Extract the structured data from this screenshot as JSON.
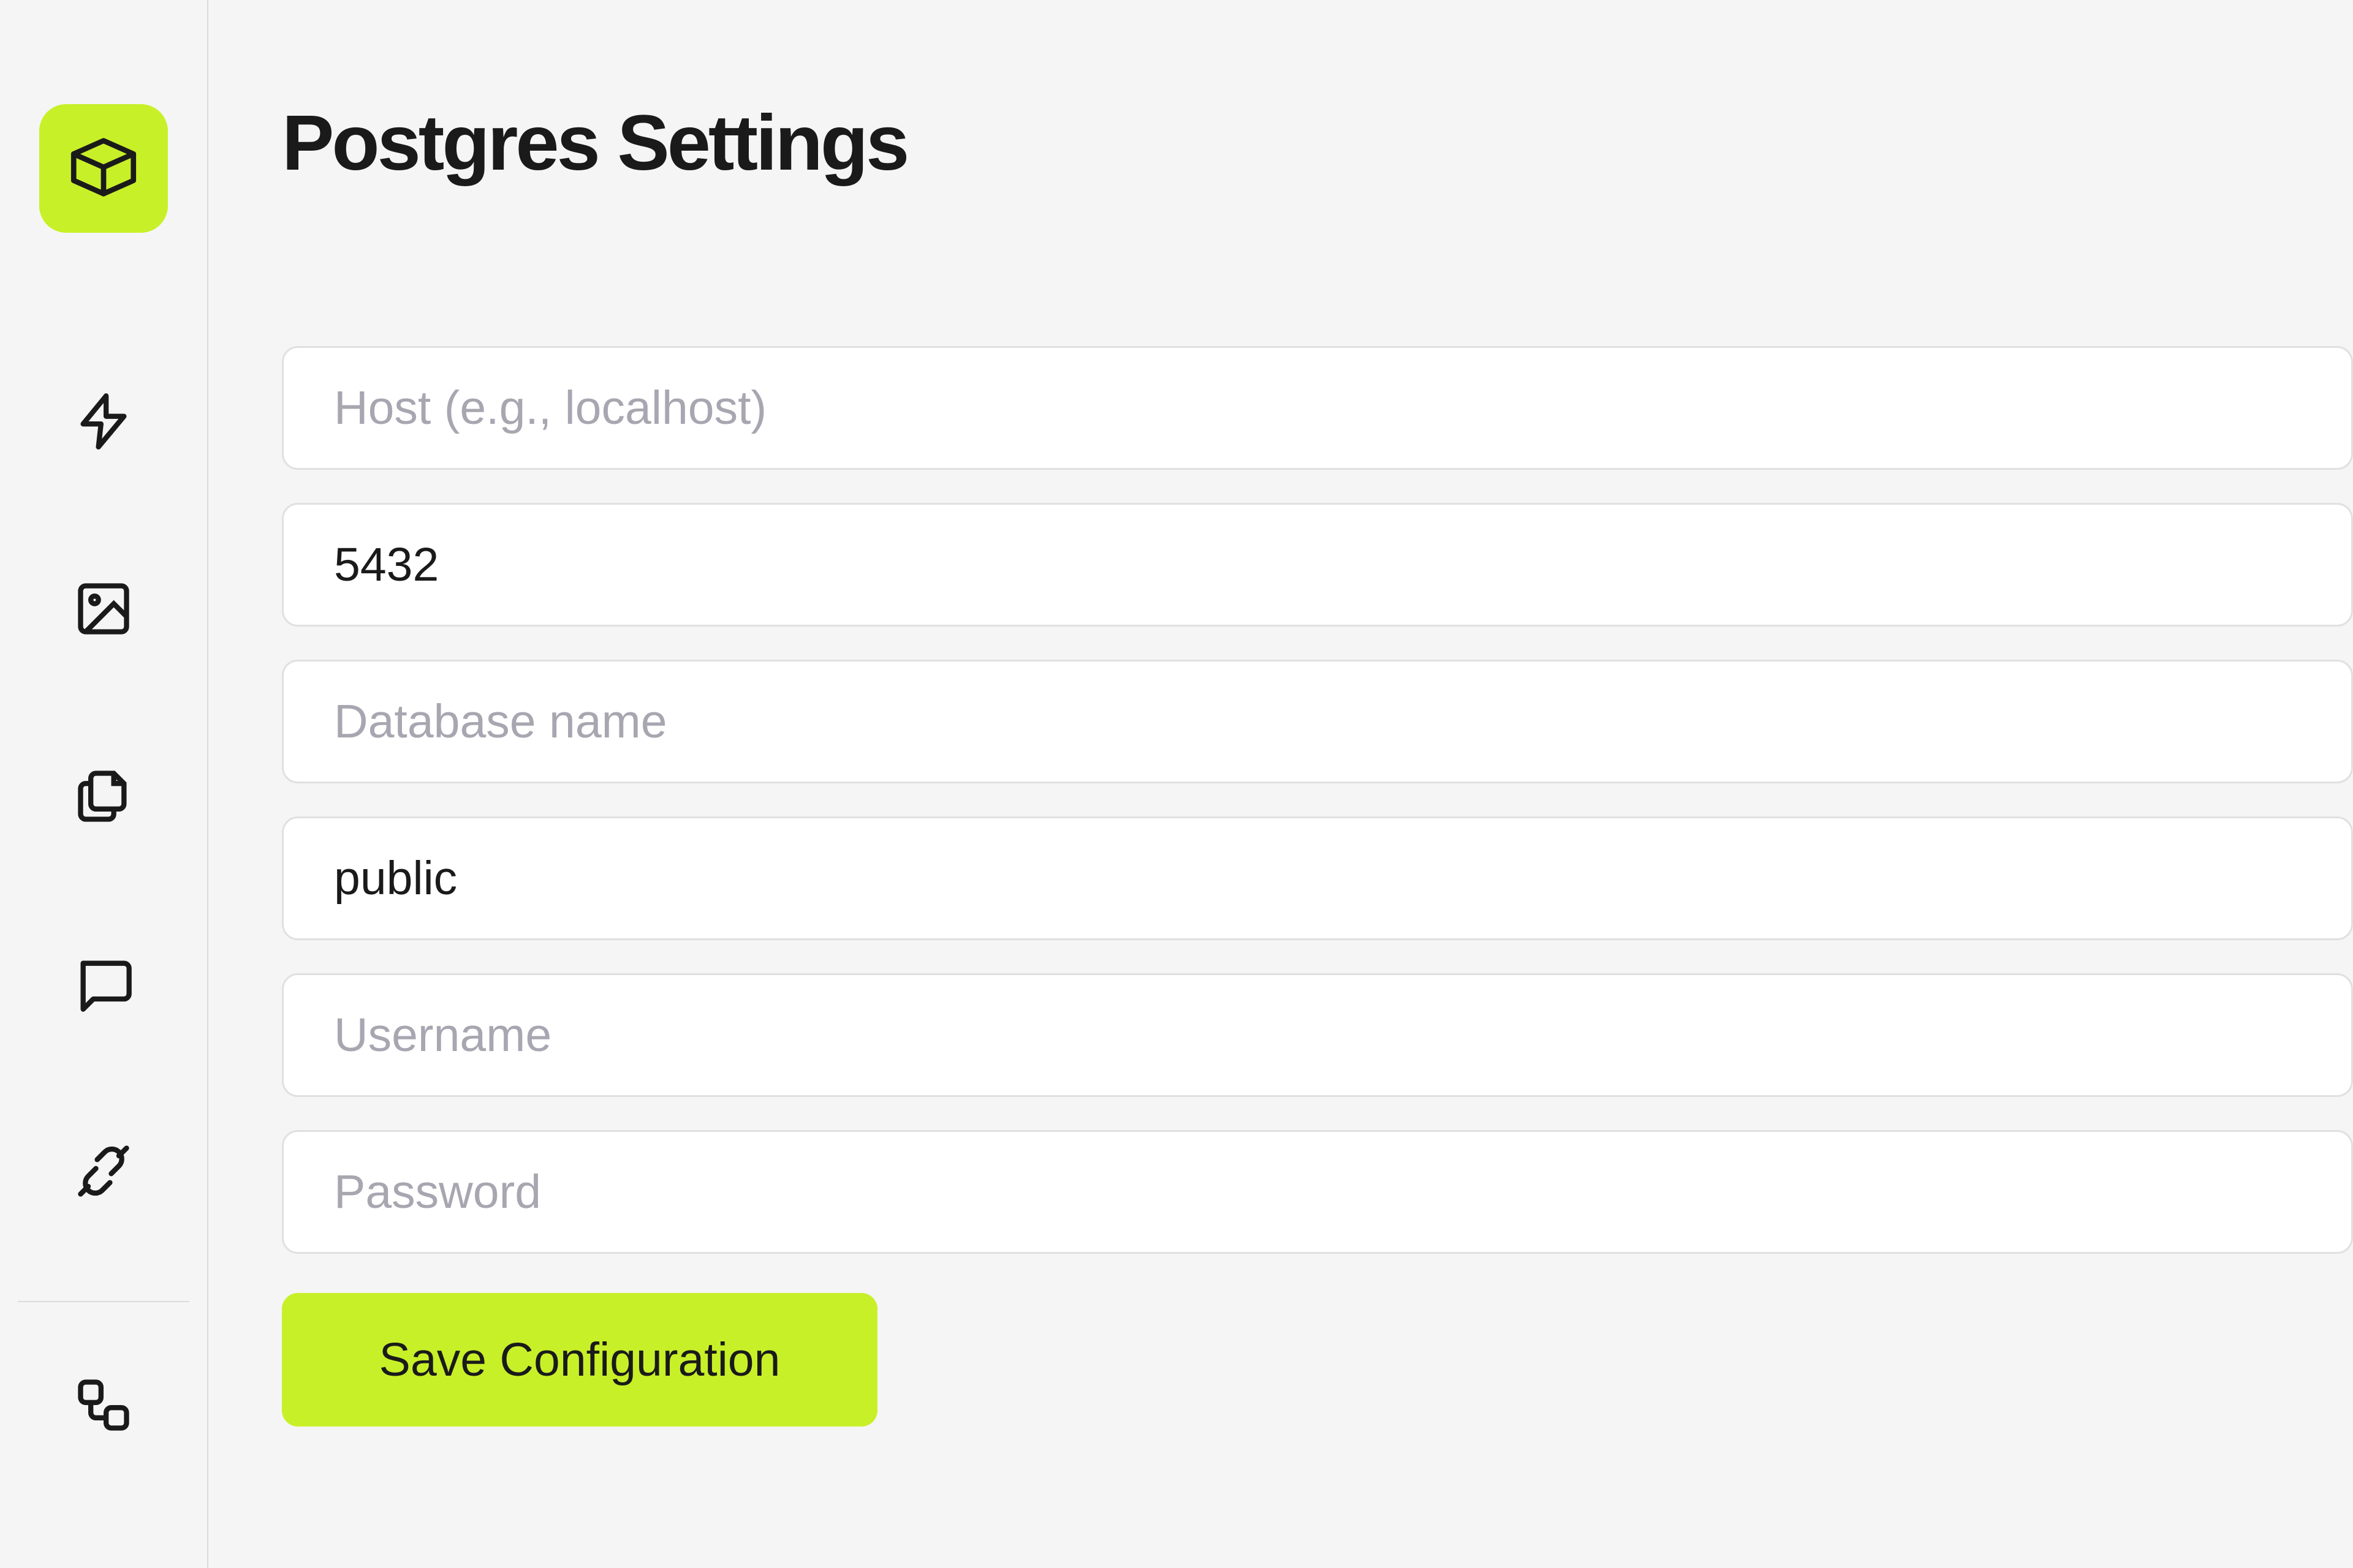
{
  "page": {
    "title": "Postgres Settings"
  },
  "form": {
    "host": {
      "value": "",
      "placeholder": "Host (e.g., localhost)"
    },
    "port": {
      "value": "5432",
      "placeholder": ""
    },
    "database": {
      "value": "",
      "placeholder": "Database name"
    },
    "schema": {
      "value": "public",
      "placeholder": ""
    },
    "username": {
      "value": "",
      "placeholder": "Username"
    },
    "password": {
      "value": "",
      "placeholder": "Password"
    },
    "save_label": "Save Configuration"
  },
  "colors": {
    "accent": "#c8f028"
  }
}
